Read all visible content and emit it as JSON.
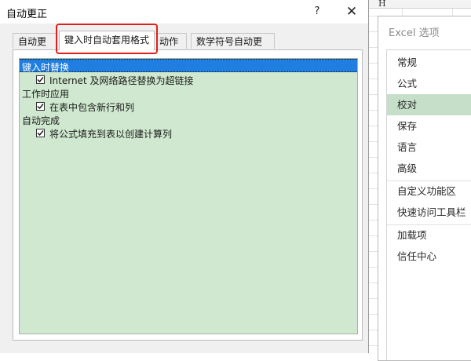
{
  "dialog": {
    "title": "自动更正",
    "help_label": "?",
    "close_label": "✕",
    "tabs": [
      {
        "label": "自动更正"
      },
      {
        "label": "键入时自动套用格式"
      },
      {
        "label": "动作"
      },
      {
        "label": "数学符号自动更正"
      }
    ],
    "active_tab": "键入时自动套用格式",
    "sections": [
      {
        "heading": "键入时替换",
        "items": [
          {
            "label": "Internet 及网络路径替换为超链接",
            "checked": true
          }
        ]
      },
      {
        "heading": "工作时应用",
        "items": [
          {
            "label": "在表中包含新行和列",
            "checked": true
          }
        ]
      },
      {
        "heading": "自动完成",
        "items": [
          {
            "label": "将公式填充到表以创建计算列",
            "checked": true
          }
        ]
      }
    ]
  },
  "options_window": {
    "title": "Excel 选项",
    "nav": [
      {
        "label": "常规"
      },
      {
        "label": "公式"
      },
      {
        "label": "校对"
      },
      {
        "label": "保存"
      },
      {
        "label": "语言"
      },
      {
        "label": "高级"
      },
      {
        "label": "自定义功能区"
      },
      {
        "label": "快速访问工具栏"
      },
      {
        "label": "加载项"
      },
      {
        "label": "信任中心"
      }
    ],
    "selected": "校对"
  },
  "sheet": {
    "column_letter": "H"
  },
  "colors": {
    "highlight": "#e0201c",
    "selection": "#1f7ee0",
    "content_bg": "#cfe8cf",
    "nav_selected": "#c5dfc9"
  }
}
